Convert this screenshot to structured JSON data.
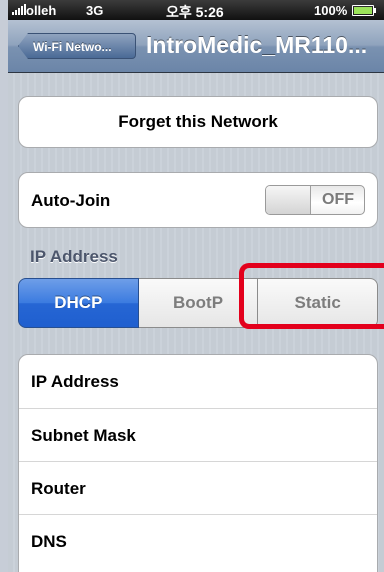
{
  "status_bar": {
    "carrier": "olleh",
    "network": "3G",
    "time": "오후 5:26",
    "battery_percent": "100%",
    "battery_color": "#9be35a"
  },
  "nav": {
    "back_label": "Wi-Fi Netwo...",
    "title": "IntroMedic_MR110..."
  },
  "forget_button": {
    "label": "Forget this Network"
  },
  "auto_join": {
    "label": "Auto-Join",
    "toggle_state": "OFF"
  },
  "ip_section": {
    "header": "IP Address",
    "segments": [
      {
        "label": "DHCP",
        "selected": true
      },
      {
        "label": "BootP",
        "selected": false
      },
      {
        "label": "Static",
        "selected": false
      }
    ],
    "highlight_color": "#e3001c"
  },
  "ip_fields": [
    {
      "label": "IP Address"
    },
    {
      "label": "Subnet Mask"
    },
    {
      "label": "Router"
    },
    {
      "label": "DNS"
    }
  ],
  "colors": {
    "selected_segment": "#2666d4",
    "navbar": "#6b85a8"
  }
}
